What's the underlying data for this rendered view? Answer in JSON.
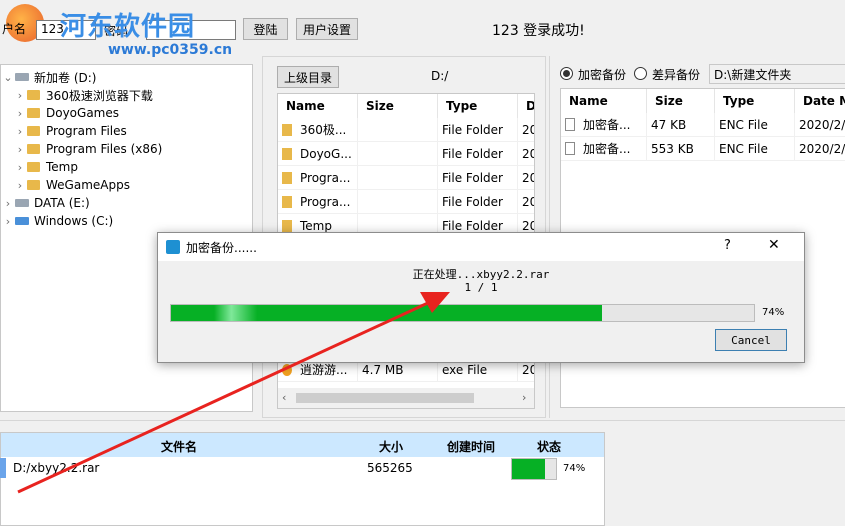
{
  "watermark": {
    "title": "河东软件园",
    "url": "www.pc0359.cn"
  },
  "login": {
    "user_label_fragment": "户名",
    "user_value": "123",
    "password_label": "密码",
    "login_button": "登陆",
    "settings_button": "用户设置",
    "status_text": "123  登录成功!"
  },
  "tree": {
    "root": "新加卷 (D:)",
    "children": [
      "360极速浏览器下载",
      "DoyoGames",
      "Program Files",
      "Program Files (x86)",
      "Temp",
      "WeGameApps"
    ],
    "others": [
      "DATA (E:)",
      "Windows (C:)"
    ]
  },
  "middle": {
    "up_button": "上级目录",
    "path": "D:/",
    "columns": [
      "Name",
      "Size",
      "Type",
      "Da"
    ],
    "rows": [
      {
        "name": "360极...",
        "size": "",
        "type": "File Folder",
        "date": "20"
      },
      {
        "name": "DoyoG...",
        "size": "",
        "type": "File Folder",
        "date": "20"
      },
      {
        "name": "Progra...",
        "size": "",
        "type": "File Folder",
        "date": "20"
      },
      {
        "name": "Progra...",
        "size": "",
        "type": "File Folder",
        "date": "20"
      },
      {
        "name": "Temp",
        "size": "",
        "type": "File Folder",
        "date": "20"
      }
    ],
    "last_row": {
      "name": "逍游游...",
      "size": "4.7 MB",
      "type": "exe File",
      "date": "20"
    }
  },
  "right": {
    "radio_encrypt": "加密备份",
    "radio_remote": "差异备份",
    "dest_path": "D:\\新建文件夹",
    "columns": [
      "Name",
      "Size",
      "Type",
      "Date M"
    ],
    "rows": [
      {
        "name": "加密备...",
        "size": "47 KB",
        "type": "ENC File",
        "date": "2020/2/"
      },
      {
        "name": "加密备...",
        "size": "553 KB",
        "type": "ENC File",
        "date": "2020/2/"
      }
    ]
  },
  "dialog": {
    "title": "加密备份......",
    "help": "?",
    "close": "✕",
    "processing": "正在处理...xbyy2.2.rar",
    "count": "1 / 1",
    "progress": 0.74,
    "progress_text": "74%",
    "cancel": "Cancel"
  },
  "bottom": {
    "columns": [
      "文件名",
      "大小",
      "创建时间",
      "状态"
    ],
    "row": {
      "name": "D:/xbyy2.2.rar",
      "size": "565265",
      "time": "",
      "progress": 0.74,
      "status": "74%"
    }
  },
  "colors": {
    "progress": "#06b025",
    "header_blue": "#cce8ff",
    "arrow": "#e8231f"
  }
}
